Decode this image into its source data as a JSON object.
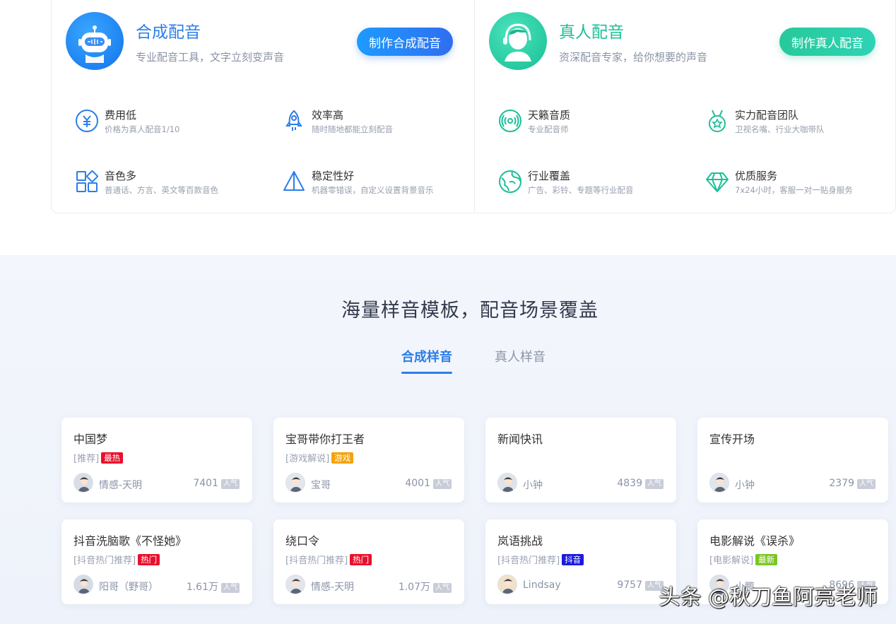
{
  "synth_panel": {
    "title": "合成配音",
    "subtitle": "专业配音工具，文字立刻变声音",
    "button": "制作合成配音",
    "features": [
      {
        "title": "费用低",
        "desc": "价格为真人配音1/10",
        "icon": "yuan-icon"
      },
      {
        "title": "效率高",
        "desc": "随时随地都能立刻配音",
        "icon": "rocket-icon"
      },
      {
        "title": "音色多",
        "desc": "普通话、方言、英文等百款音色",
        "icon": "grid-icon"
      },
      {
        "title": "稳定性好",
        "desc": "机器零错误，自定义设置背景音乐",
        "icon": "pyramid-icon"
      }
    ]
  },
  "human_panel": {
    "title": "真人配音",
    "subtitle": "资深配音专家，给你想要的声音",
    "button": "制作真人配音",
    "features": [
      {
        "title": "天籁音质",
        "desc": "专业配音师",
        "icon": "sound-wave-icon"
      },
      {
        "title": "实力配音团队",
        "desc": "卫视名嘴、行业大咖带队",
        "icon": "medal-icon"
      },
      {
        "title": "行业覆盖",
        "desc": "广告、彩铃、专题等行业配音",
        "icon": "globe-icon"
      },
      {
        "title": "优质服务",
        "desc": "7x24小时，客服一对一贴身服务",
        "icon": "diamond-icon"
      }
    ]
  },
  "templates": {
    "heading": "海量样音模板，配音场景覆盖",
    "tabs": [
      "合成样音",
      "真人样音"
    ],
    "active_tab": 0,
    "popularity_label": "人气",
    "cards": [
      {
        "title": "中国梦",
        "tag": "[推荐]",
        "badge": "最热",
        "badge_color": "#e8102c",
        "voice": "情感-天明",
        "popularity": "7401"
      },
      {
        "title": "宝哥带你打王者",
        "tag": "[游戏解说]",
        "badge": "游戏",
        "badge_color": "#f5a20a",
        "voice": "宝哥",
        "popularity": "4001"
      },
      {
        "title": "新闻快讯",
        "tag": "",
        "badge": "",
        "badge_color": "",
        "voice": "小钟",
        "popularity": "4839"
      },
      {
        "title": "宣传开场",
        "tag": "",
        "badge": "",
        "badge_color": "",
        "voice": "小钟",
        "popularity": "2379"
      },
      {
        "title": "抖音洗脑歌《不怪她》",
        "tag": "[抖音热门推荐]",
        "badge": "热门",
        "badge_color": "#e8102c",
        "voice": "阳哥（野哥）",
        "popularity": "1.61万"
      },
      {
        "title": "绕口令",
        "tag": "[抖音热门推荐]",
        "badge": "热门",
        "badge_color": "#e8102c",
        "voice": "情感-天明",
        "popularity": "1.07万"
      },
      {
        "title": "岚语挑战",
        "tag": "[抖音热门推荐]",
        "badge": "抖音",
        "badge_color": "#1a1ae0",
        "voice": "Lindsay",
        "popularity": "9757"
      },
      {
        "title": "电影解说《误杀》",
        "tag": "[电影解说]",
        "badge": "最新",
        "badge_color": "#7cc527",
        "voice": "小鹏",
        "popularity": "8696"
      }
    ]
  },
  "watermark": "头条 @秋刀鱼阿亮老师",
  "colors": {
    "blue": "#2b7ee8",
    "green": "#1cbf98"
  }
}
